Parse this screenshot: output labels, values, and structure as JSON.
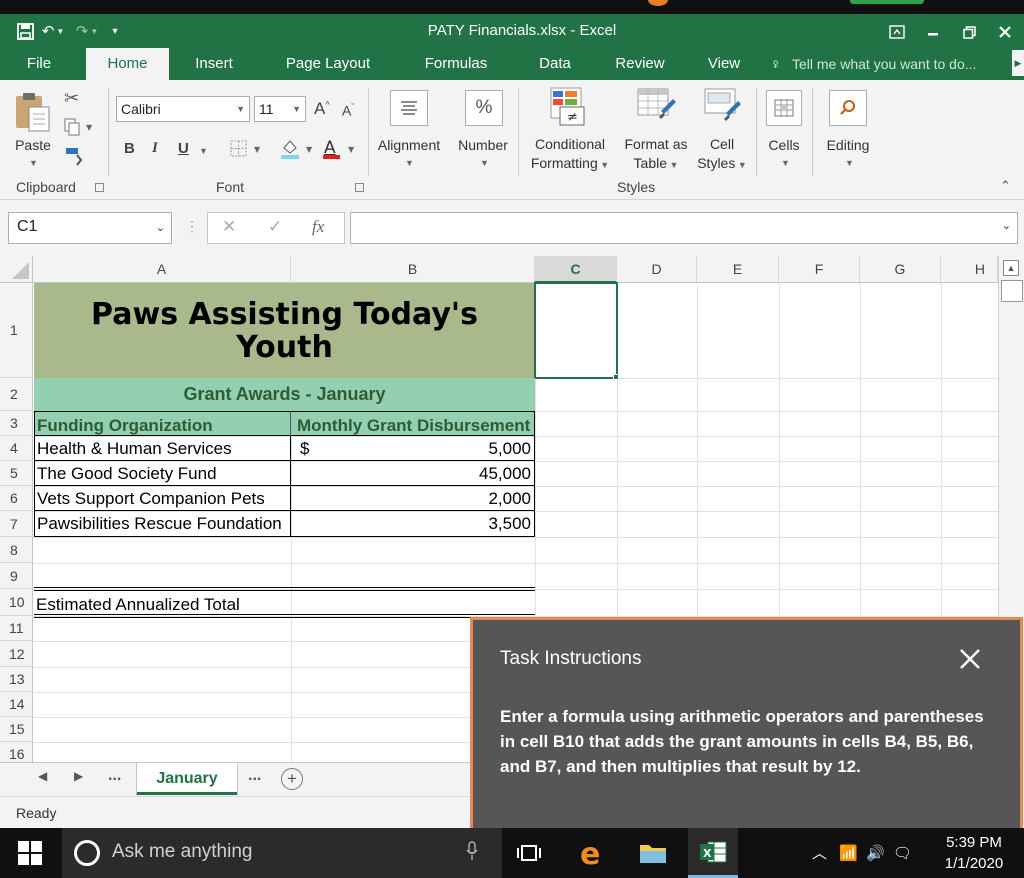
{
  "window": {
    "title": "PATY Financials.xlsx - Excel",
    "accent_color": "#217346"
  },
  "menu": {
    "tabs": [
      "File",
      "Home",
      "Insert",
      "Page Layout",
      "Formulas",
      "Data",
      "Review",
      "View"
    ],
    "active_tab": "Home",
    "tell_me": "Tell me what you want to do..."
  },
  "ribbon": {
    "clipboard": {
      "paste": "Paste",
      "group": "Clipboard"
    },
    "font": {
      "name": "Calibri",
      "size": "11",
      "bold": "B",
      "italic": "I",
      "underline": "U",
      "grow": "A",
      "shrink": "A",
      "font_color": "A",
      "group": "Font"
    },
    "alignment": "Alignment",
    "number": "Number",
    "styles": {
      "conditional_1": "Conditional",
      "conditional_2": "Formatting",
      "format_table_1": "Format as",
      "format_table_2": "Table",
      "cell_styles_1": "Cell",
      "cell_styles_2": "Styles",
      "group": "Styles"
    },
    "cells": "Cells",
    "editing": "Editing"
  },
  "formula_bar": {
    "name_box": "C1",
    "fx": "fx",
    "content": ""
  },
  "grid": {
    "columns": [
      "A",
      "B",
      "C",
      "D",
      "E",
      "F",
      "G",
      "H"
    ],
    "selected_column": "C",
    "rows": [
      "1",
      "2",
      "3",
      "4",
      "5",
      "6",
      "7",
      "8",
      "9",
      "10",
      "11",
      "12",
      "13",
      "14",
      "15",
      "16"
    ],
    "title": "Paws Assisting Today's Youth",
    "subtitle": "Grant Awards - January",
    "header_a": "Funding Organization",
    "header_b": "Monthly Grant Disbursement",
    "data": [
      {
        "org": "Health & Human Services",
        "currency": "$",
        "amount": "5,000"
      },
      {
        "org": "The Good Society Fund",
        "currency": "",
        "amount": "45,000"
      },
      {
        "org": "Vets Support Companion Pets",
        "currency": "",
        "amount": "2,000"
      },
      {
        "org": "Pawsibilities Rescue Foundation",
        "currency": "",
        "amount": "3,500"
      }
    ],
    "total_label": "Estimated Annualized Total",
    "title_fill": "#a9b98b",
    "subtitle_fill": "#93cfb1"
  },
  "sheets": {
    "nav_more": "...",
    "active": "January",
    "more": "..."
  },
  "status": {
    "text": "Ready"
  },
  "task_panel": {
    "title": "Task Instructions",
    "body": "Enter a formula using arithmetic operators and parentheses in cell B10 that adds the grant amounts in cells B4, B5, B6, and B7, and then multiplies that result by 12."
  },
  "taskbar": {
    "search": "Ask me anything",
    "time": "5:39 PM",
    "date": "1/1/2020"
  }
}
